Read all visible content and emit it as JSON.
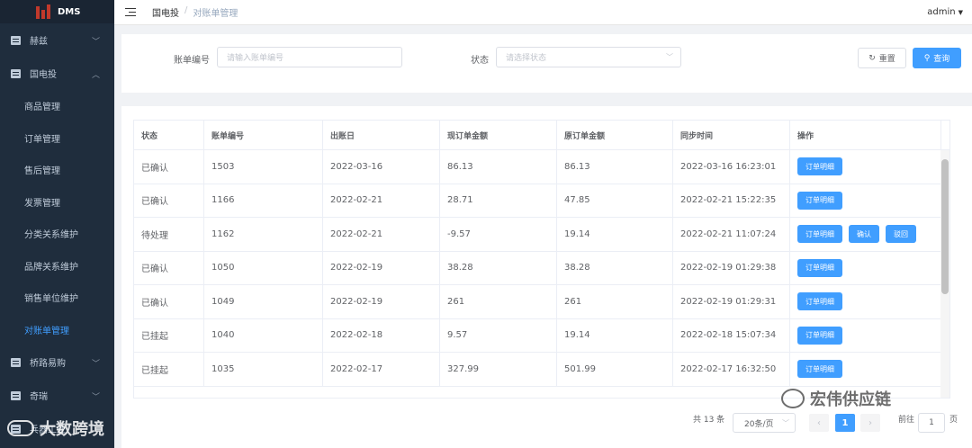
{
  "app": {
    "logo_text": "DMS",
    "user": "admin"
  },
  "sidebar": {
    "groups_top": [
      {
        "label": "赫兹"
      }
    ],
    "active_group": {
      "label": "国电投"
    },
    "sub_items": [
      {
        "label": "商品管理"
      },
      {
        "label": "订单管理"
      },
      {
        "label": "售后管理"
      },
      {
        "label": "发票管理"
      },
      {
        "label": "分类关系维护"
      },
      {
        "label": "品牌关系维护"
      },
      {
        "label": "销售单位维护"
      },
      {
        "label": "对账单管理"
      }
    ],
    "groups_bottom": [
      {
        "label": "桥路易购"
      },
      {
        "label": "奇瑞"
      },
      {
        "label": "兵器工业"
      }
    ]
  },
  "breadcrumb": {
    "root": "国电投",
    "separator": "/",
    "current": "对账单管理"
  },
  "search": {
    "bill_no_label": "账单编号",
    "bill_no_placeholder": "请输入账单编号",
    "status_label": "状态",
    "status_placeholder": "请选择状态",
    "reset_label": "重置",
    "query_label": "查询"
  },
  "table": {
    "headers": [
      "状态",
      "账单编号",
      "出账日",
      "现订单金额",
      "原订单金额",
      "同步时间",
      "操作"
    ],
    "rows": [
      {
        "status": "已确认",
        "bill_no": "1503",
        "bill_date": "2022-03-16",
        "cur_amount": "86.13",
        "orig_amount": "86.13",
        "sync_time": "2022-03-16 16:23:01",
        "actions": [
          "订单明细"
        ]
      },
      {
        "status": "已确认",
        "bill_no": "1166",
        "bill_date": "2022-02-21",
        "cur_amount": "28.71",
        "orig_amount": "47.85",
        "sync_time": "2022-02-21 15:22:35",
        "actions": [
          "订单明细"
        ]
      },
      {
        "status": "待处理",
        "bill_no": "1162",
        "bill_date": "2022-02-21",
        "cur_amount": "-9.57",
        "orig_amount": "19.14",
        "sync_time": "2022-02-21 11:07:24",
        "actions": [
          "订单明细",
          "确认",
          "驳回"
        ]
      },
      {
        "status": "已确认",
        "bill_no": "1050",
        "bill_date": "2022-02-19",
        "cur_amount": "38.28",
        "orig_amount": "38.28",
        "sync_time": "2022-02-19 01:29:38",
        "actions": [
          "订单明细"
        ]
      },
      {
        "status": "已确认",
        "bill_no": "1049",
        "bill_date": "2022-02-19",
        "cur_amount": "261",
        "orig_amount": "261",
        "sync_time": "2022-02-19 01:29:31",
        "actions": [
          "订单明细"
        ]
      },
      {
        "status": "已挂起",
        "bill_no": "1040",
        "bill_date": "2022-02-18",
        "cur_amount": "9.57",
        "orig_amount": "19.14",
        "sync_time": "2022-02-18 15:07:34",
        "actions": [
          "订单明细"
        ]
      },
      {
        "status": "已挂起",
        "bill_no": "1035",
        "bill_date": "2022-02-17",
        "cur_amount": "327.99",
        "orig_amount": "501.99",
        "sync_time": "2022-02-17 16:32:50",
        "actions": [
          "订单明细"
        ]
      }
    ]
  },
  "pagination": {
    "total_text": "共 13 条",
    "page_size": "20条/页",
    "current_page": "1",
    "goto_label": "前往",
    "goto_value": "1",
    "page_suffix": "页"
  },
  "watermarks": {
    "left": "大数跨境",
    "right": "宏伟供应链"
  },
  "colors": {
    "primary": "#409eff",
    "sidebar_bg": "#1f2d3d"
  }
}
